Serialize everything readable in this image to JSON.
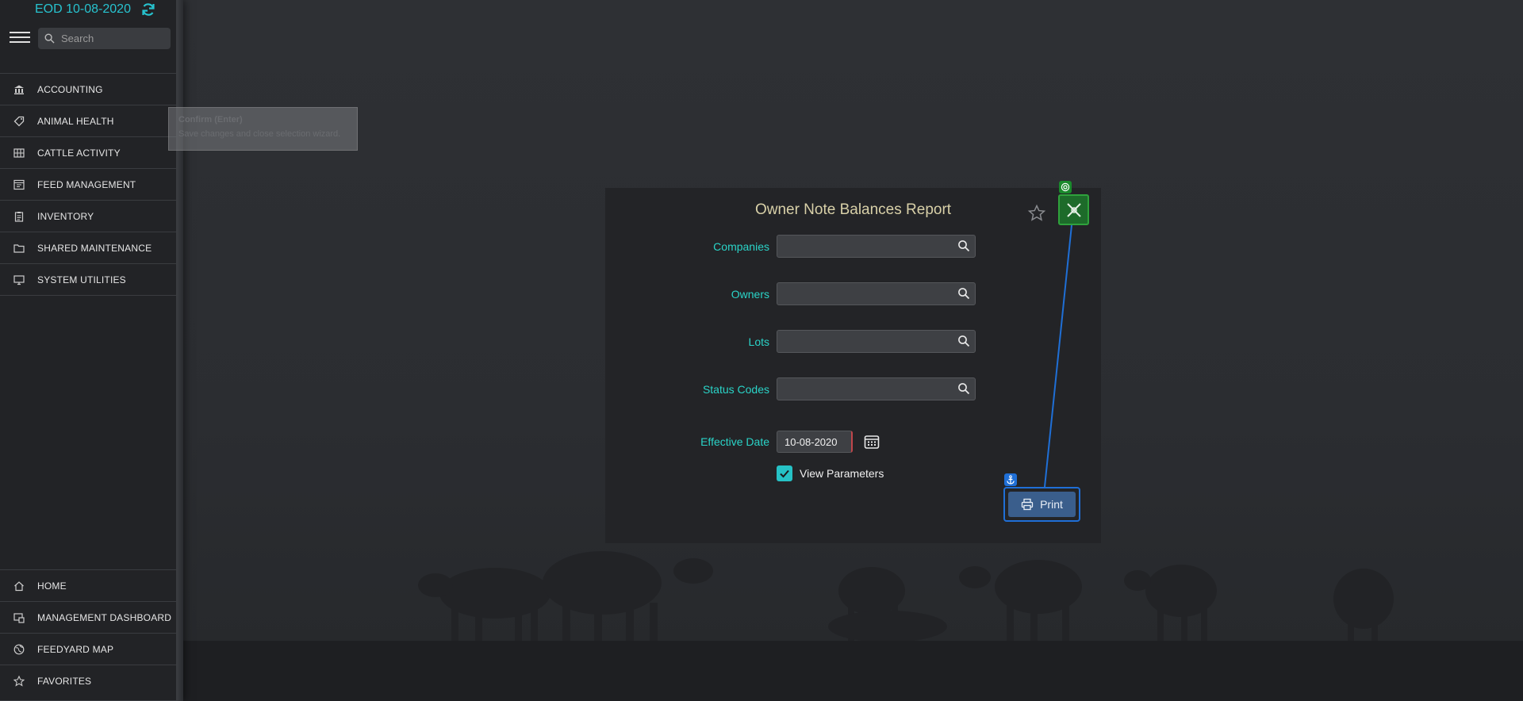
{
  "header": {
    "eod_label": "EOD  10-08-2020",
    "refresh_icon": "refresh-icon"
  },
  "search": {
    "placeholder": "Search",
    "value": ""
  },
  "sidebar": {
    "items": [
      {
        "label": "ACCOUNTING",
        "icon": "bank-icon"
      },
      {
        "label": "ANIMAL HEALTH",
        "icon": "tag-icon"
      },
      {
        "label": "CATTLE ACTIVITY",
        "icon": "grid-pen-icon"
      },
      {
        "label": "FEED MANAGEMENT",
        "icon": "feed-icon"
      },
      {
        "label": "INVENTORY",
        "icon": "clipboard-icon"
      },
      {
        "label": "SHARED MAINTENANCE",
        "icon": "folder-icon"
      },
      {
        "label": "SYSTEM UTILITIES",
        "icon": "monitor-icon"
      }
    ],
    "bottom_items": [
      {
        "label": "HOME",
        "icon": "home-icon"
      },
      {
        "label": "MANAGEMENT DASHBOARD",
        "icon": "dashboard-icon"
      },
      {
        "label": "FEEDYARD MAP",
        "icon": "globe-icon"
      },
      {
        "label": "FAVORITES",
        "icon": "star-icon"
      }
    ]
  },
  "tooltip": {
    "title": "Confirm (Enter)",
    "text": "Save changes and close selection wizard."
  },
  "dialog": {
    "title": "Owner Note Balances Report",
    "fields": [
      {
        "label": "Companies",
        "value": ""
      },
      {
        "label": "Owners",
        "value": ""
      },
      {
        "label": "Lots",
        "value": ""
      },
      {
        "label": "Status Codes",
        "value": ""
      }
    ],
    "effective_date_label": "Effective Date",
    "effective_date_value": "10-08-2020",
    "view_parameters_label": "View Parameters",
    "view_parameters_checked": true,
    "print_label": "Print"
  },
  "colors": {
    "accent": "#2ad4c8",
    "title": "#d8d0a8",
    "eod": "#27c3cf",
    "designer_green": "#2fa23c",
    "designer_blue": "#1f6fd6"
  }
}
